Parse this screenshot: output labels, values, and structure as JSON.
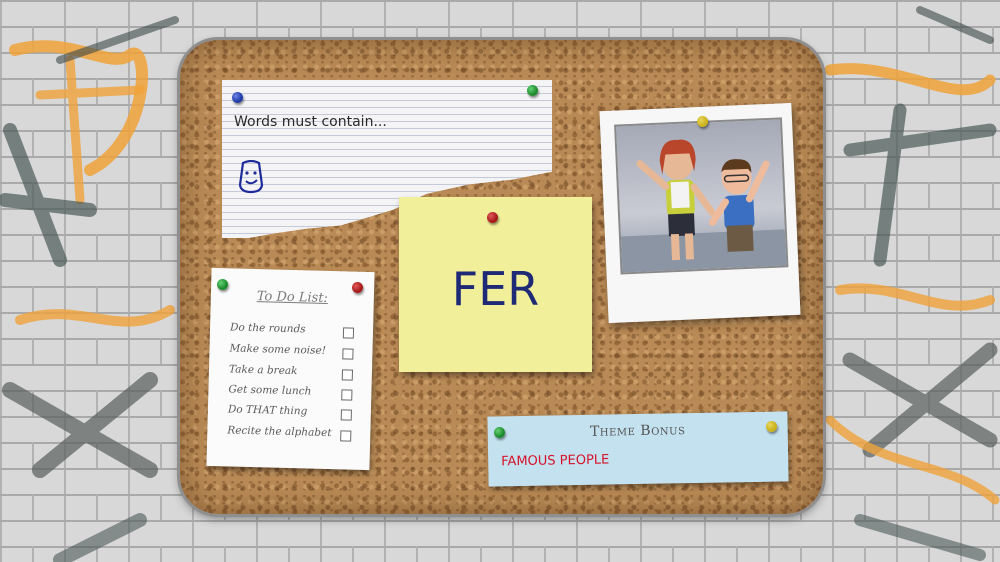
{
  "notebook": {
    "text": "Words must contain...",
    "icon": "smiley-face-icon"
  },
  "sticky_note": {
    "word": "FER"
  },
  "todo_list": {
    "title": "To Do List:",
    "items": [
      "Do the rounds",
      "Make some noise!",
      "Take a break",
      "Get some lunch",
      "Do THAT thing",
      "Recite the alphabet"
    ]
  },
  "theme_bonus": {
    "title": "Theme Bonus",
    "value": "FAMOUS PEOPLE"
  },
  "colors": {
    "cork": "#b98a55",
    "sticky": "#f2ef9a",
    "sticky_text": "#1e2a76",
    "theme_card": "#c4e1ef",
    "theme_value": "#d6132a",
    "pin_blue": "#1f3aa6",
    "pin_green": "#1d8a2e",
    "pin_red": "#a51919",
    "pin_yellow": "#c9b21a"
  }
}
